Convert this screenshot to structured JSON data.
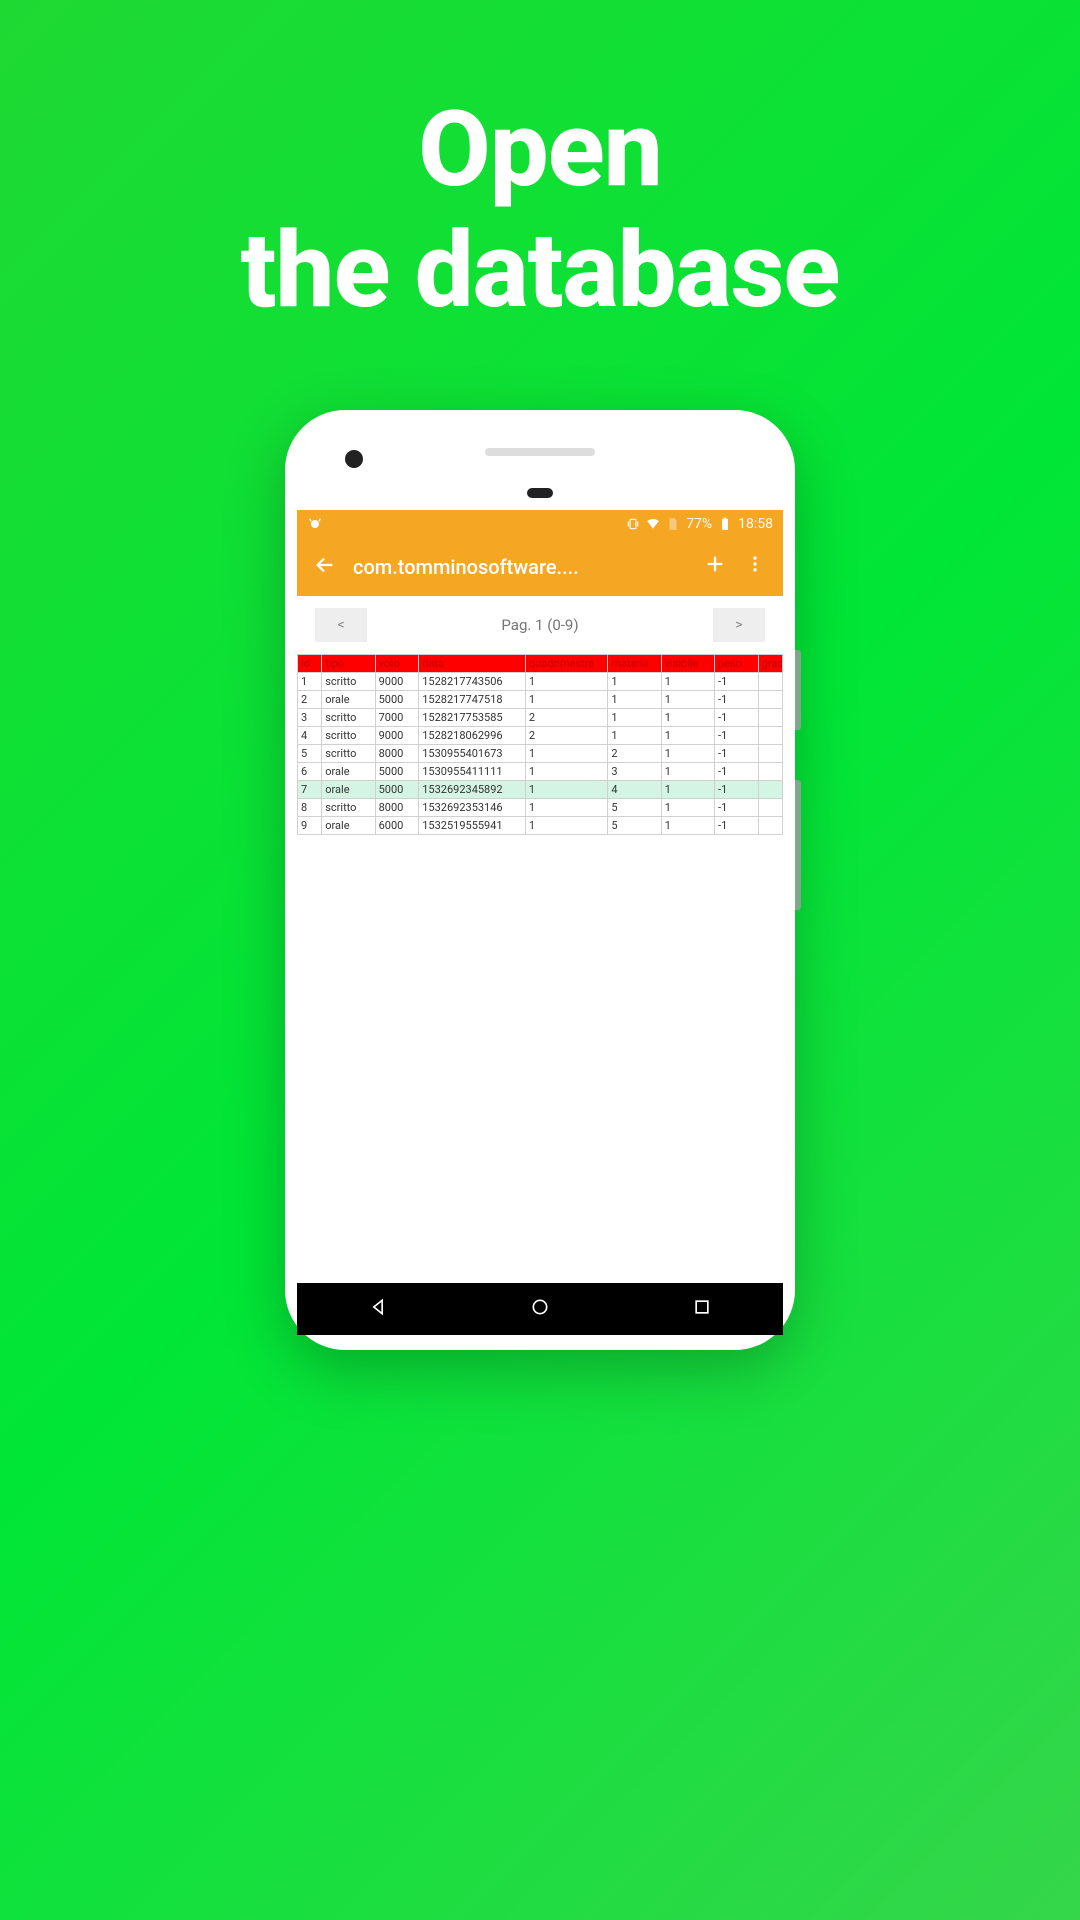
{
  "promo": {
    "line1": "Open",
    "line2": "the database"
  },
  "statusbar": {
    "battery_pct": "77%",
    "time": "18:58"
  },
  "appbar": {
    "title": "com.tomminosoftware...."
  },
  "pager": {
    "prev": "<",
    "label": "Pag. 1 (0-9)",
    "next": ">"
  },
  "table": {
    "columns": [
      "id",
      "tipo",
      "voto",
      "data",
      "quadrimestre",
      "materia",
      "visibile",
      "peso",
      "grad"
    ],
    "rows": [
      {
        "id": "1",
        "tipo": "scritto",
        "voto": "9000",
        "data": "1528217743506",
        "quadrimestre": "1",
        "materia": "1",
        "visibile": "1",
        "peso": "-1",
        "grad": "",
        "hl": false
      },
      {
        "id": "2",
        "tipo": "orale",
        "voto": "5000",
        "data": "1528217747518",
        "quadrimestre": "1",
        "materia": "1",
        "visibile": "1",
        "peso": "-1",
        "grad": "",
        "hl": false
      },
      {
        "id": "3",
        "tipo": "scritto",
        "voto": "7000",
        "data": "1528217753585",
        "quadrimestre": "2",
        "materia": "1",
        "visibile": "1",
        "peso": "-1",
        "grad": "",
        "hl": false
      },
      {
        "id": "4",
        "tipo": "scritto",
        "voto": "9000",
        "data": "1528218062996",
        "quadrimestre": "2",
        "materia": "1",
        "visibile": "1",
        "peso": "-1",
        "grad": "",
        "hl": false
      },
      {
        "id": "5",
        "tipo": "scritto",
        "voto": "8000",
        "data": "1530955401673",
        "quadrimestre": "1",
        "materia": "2",
        "visibile": "1",
        "peso": "-1",
        "grad": "",
        "hl": false
      },
      {
        "id": "6",
        "tipo": "orale",
        "voto": "5000",
        "data": "1530955411111",
        "quadrimestre": "1",
        "materia": "3",
        "visibile": "1",
        "peso": "-1",
        "grad": "",
        "hl": false
      },
      {
        "id": "7",
        "tipo": "orale",
        "voto": "5000",
        "data": "1532692345892",
        "quadrimestre": "1",
        "materia": "4",
        "visibile": "1",
        "peso": "-1",
        "grad": "",
        "hl": true
      },
      {
        "id": "8",
        "tipo": "scritto",
        "voto": "8000",
        "data": "1532692353146",
        "quadrimestre": "1",
        "materia": "5",
        "visibile": "1",
        "peso": "-1",
        "grad": "",
        "hl": false
      },
      {
        "id": "9",
        "tipo": "orale",
        "voto": "6000",
        "data": "1532519555941",
        "quadrimestre": "1",
        "materia": "5",
        "visibile": "1",
        "peso": "-1",
        "grad": "",
        "hl": false
      }
    ]
  },
  "colwidths": [
    "5%",
    "11%",
    "9%",
    "22%",
    "17%",
    "11%",
    "11%",
    "9%",
    "5%"
  ]
}
